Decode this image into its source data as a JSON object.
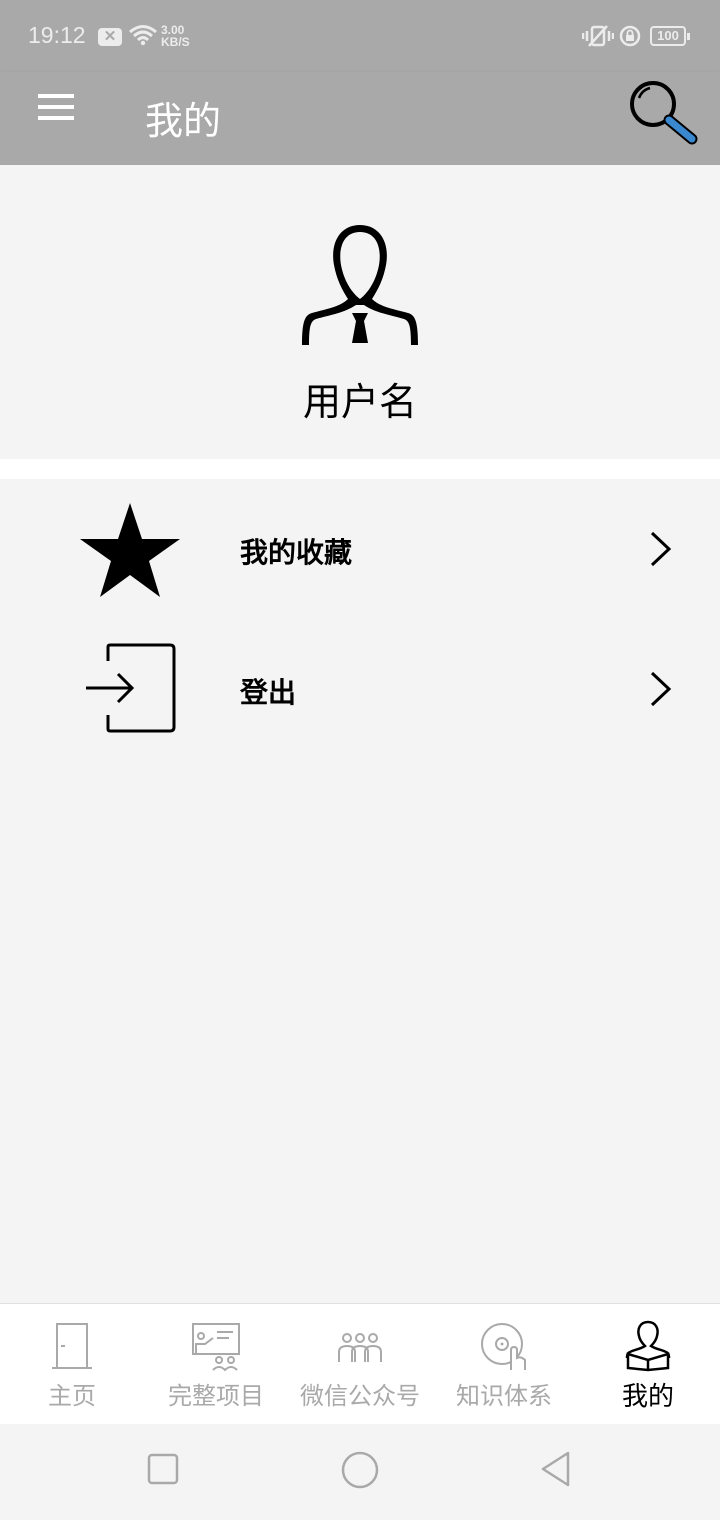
{
  "status_bar": {
    "time": "19:12",
    "notification_badge": "✕",
    "speed_value": "3.00",
    "speed_unit": "KB/S",
    "battery": "100"
  },
  "app_bar": {
    "title": "我的",
    "menu_icon": "hamburger-menu-icon",
    "search_icon": "magnifier-icon"
  },
  "profile": {
    "avatar_icon": "user-silhouette-icon",
    "username": "用户名"
  },
  "menu": {
    "items": [
      {
        "label": "我的收藏",
        "icon": "star-icon"
      },
      {
        "label": "登出",
        "icon": "sign-in-icon"
      }
    ]
  },
  "bottom_nav": {
    "items": [
      {
        "label": "主页",
        "icon": "door-icon",
        "active": false
      },
      {
        "label": "完整项目",
        "icon": "presentation-icon",
        "active": false
      },
      {
        "label": "微信公众号",
        "icon": "group-icon",
        "active": false
      },
      {
        "label": "知识体系",
        "icon": "disc-hand-icon",
        "active": false
      },
      {
        "label": "我的",
        "icon": "reader-icon",
        "active": true
      }
    ]
  },
  "colors": {
    "app_bar": "#a9a9a9",
    "background": "#f4f4f4",
    "nav_inactive": "#a9a9a9",
    "nav_active": "#000000",
    "search_handle": "#3a88d0"
  }
}
